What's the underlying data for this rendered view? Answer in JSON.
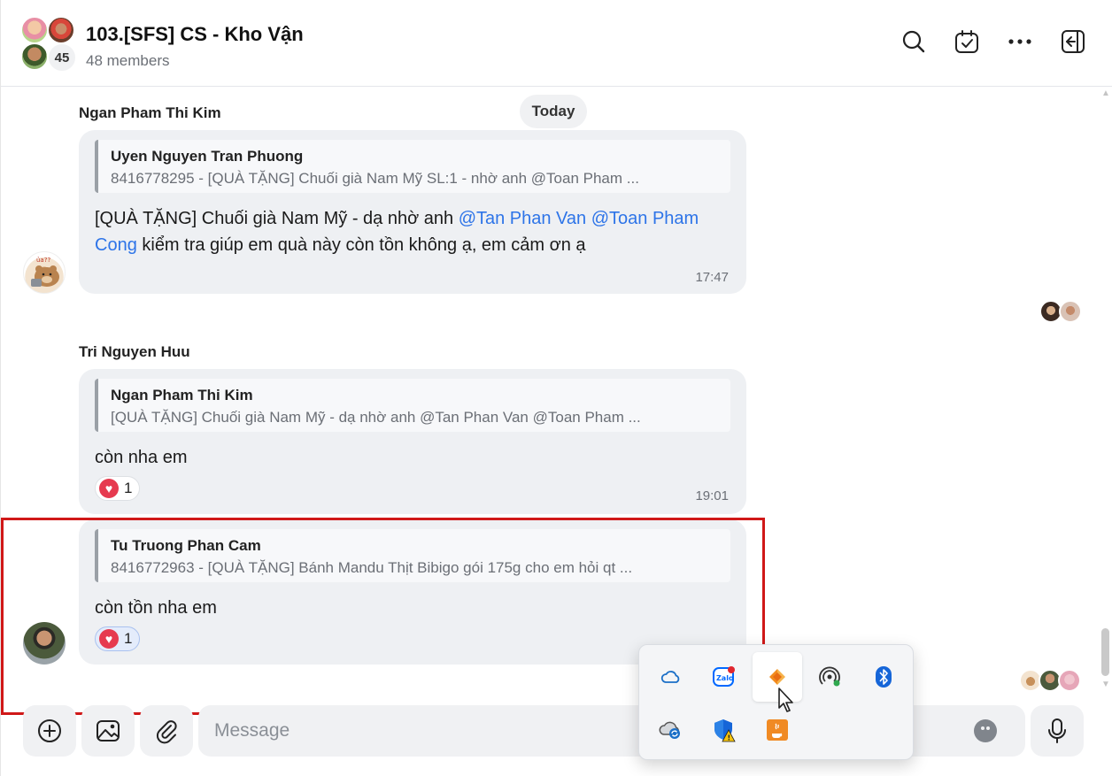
{
  "header": {
    "title": "103.[SFS] CS - Kho Vận",
    "subtitle": "48 members",
    "avatar_count": "45"
  },
  "date_divider": "Today",
  "messages": [
    {
      "sender": "Ngan Pham Thi Kim",
      "quote_name": "Uyen Nguyen Tran Phuong",
      "quote_text": "8416778295 - [QUÀ TẶNG] Chuối già Nam Mỹ SL:1 - nhờ anh @Toan Pham ...",
      "text_prefix": "[QUÀ TẶNG] Chuối già Nam Mỹ - dạ nhờ anh ",
      "mention_1": "@Tan Phan Van",
      "mention_2": "@Toan Pham Cong",
      "text_suffix": "  kiểm tra giúp em quà này còn tồn không ạ, em cảm ơn ạ",
      "time": "17:47"
    },
    {
      "sender": "Tri Nguyen Huu",
      "quote_name": "Ngan Pham Thi Kim",
      "quote_text": "[QUÀ TẶNG] Chuối già Nam Mỹ - dạ nhờ anh @Tan Phan Van @Toan Pham ...",
      "text": "còn nha em",
      "reaction_count": "1",
      "time": "19:01"
    },
    {
      "quote_name": "Tu Truong Phan Cam",
      "quote_text": "8416772963 - [QUÀ TẶNG] Bánh Mandu Thịt Bibigo gói 175g cho em hỏi qt ...",
      "text": "còn tồn nha em",
      "reaction_count": "1"
    }
  ],
  "composer": {
    "placeholder": "Message"
  },
  "tray": {
    "icons": [
      "onedrive-icon",
      "zalo-icon",
      "app-icon",
      "hotspot-icon",
      "bluetooth-icon",
      "cloud-sync-icon",
      "security-warning-icon",
      "java-icon"
    ]
  },
  "colors": {
    "mention": "#2d74e8",
    "bubble": "#eef0f3",
    "highlight": "#d01818",
    "heart": "#e63a4f"
  }
}
